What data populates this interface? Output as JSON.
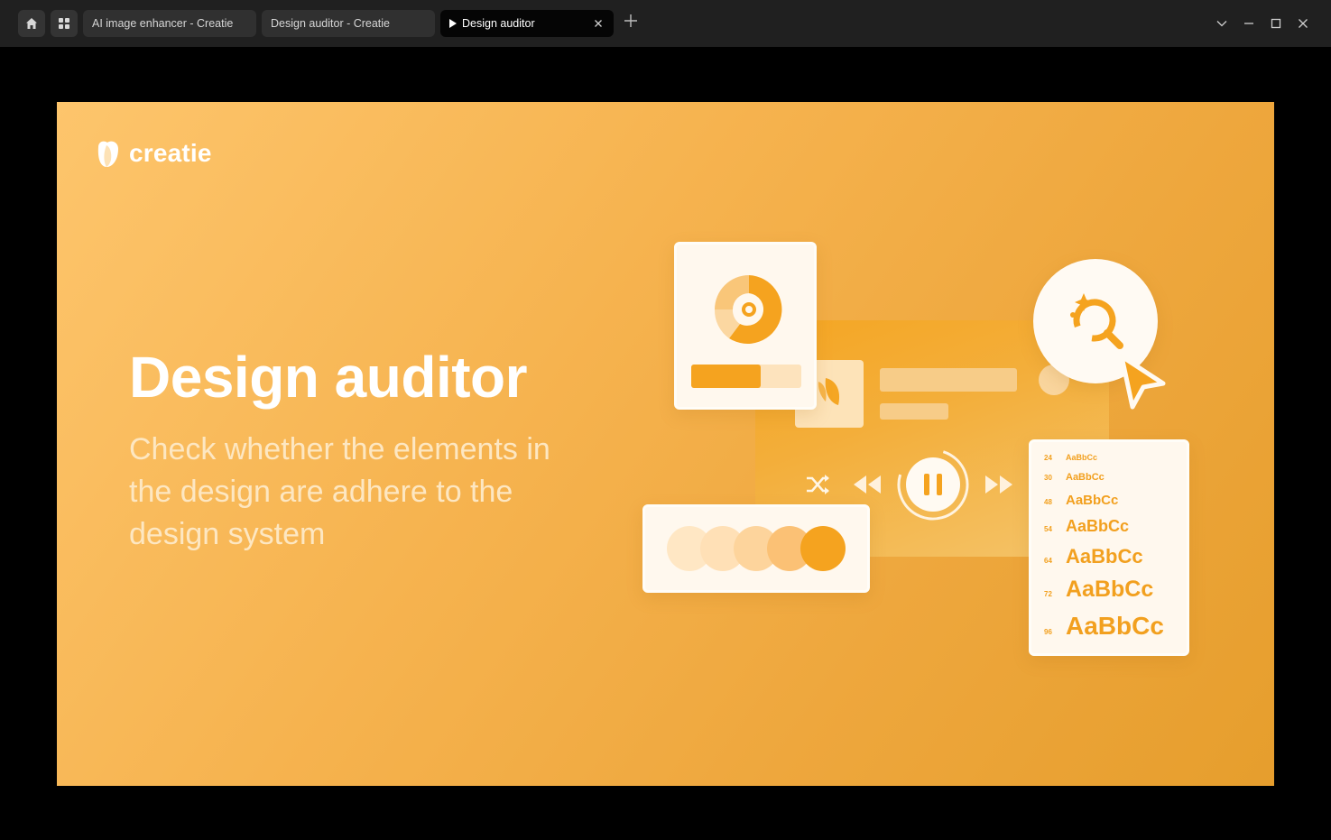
{
  "browser": {
    "tabs": [
      {
        "title": "AI image enhancer - Creatie",
        "active": false
      },
      {
        "title": "Design auditor - Creatie",
        "active": false
      },
      {
        "title": "Design auditor",
        "active": true
      }
    ]
  },
  "slide": {
    "brand": "creatie",
    "headline": "Design auditor",
    "subline": "Check whether the elements in the design are adhere to the design system"
  },
  "typography_samples": [
    {
      "size": "24",
      "sample": "AaBbCc"
    },
    {
      "size": "30",
      "sample": "AaBbCc"
    },
    {
      "size": "48",
      "sample": "AaBbCc"
    },
    {
      "size": "54",
      "sample": "AaBbCc"
    },
    {
      "size": "64",
      "sample": "AaBbCc"
    },
    {
      "size": "72",
      "sample": "AaBbCc"
    },
    {
      "size": "96",
      "sample": "AaBbCc"
    }
  ],
  "progress": {
    "value": 0.63
  },
  "swatches": [
    "#ffe7c4",
    "#ffe0b6",
    "#fdd49c",
    "#fbc175",
    "#f5a31f"
  ],
  "colors": {
    "accent": "#f5a31f",
    "chrome": "#202020"
  }
}
